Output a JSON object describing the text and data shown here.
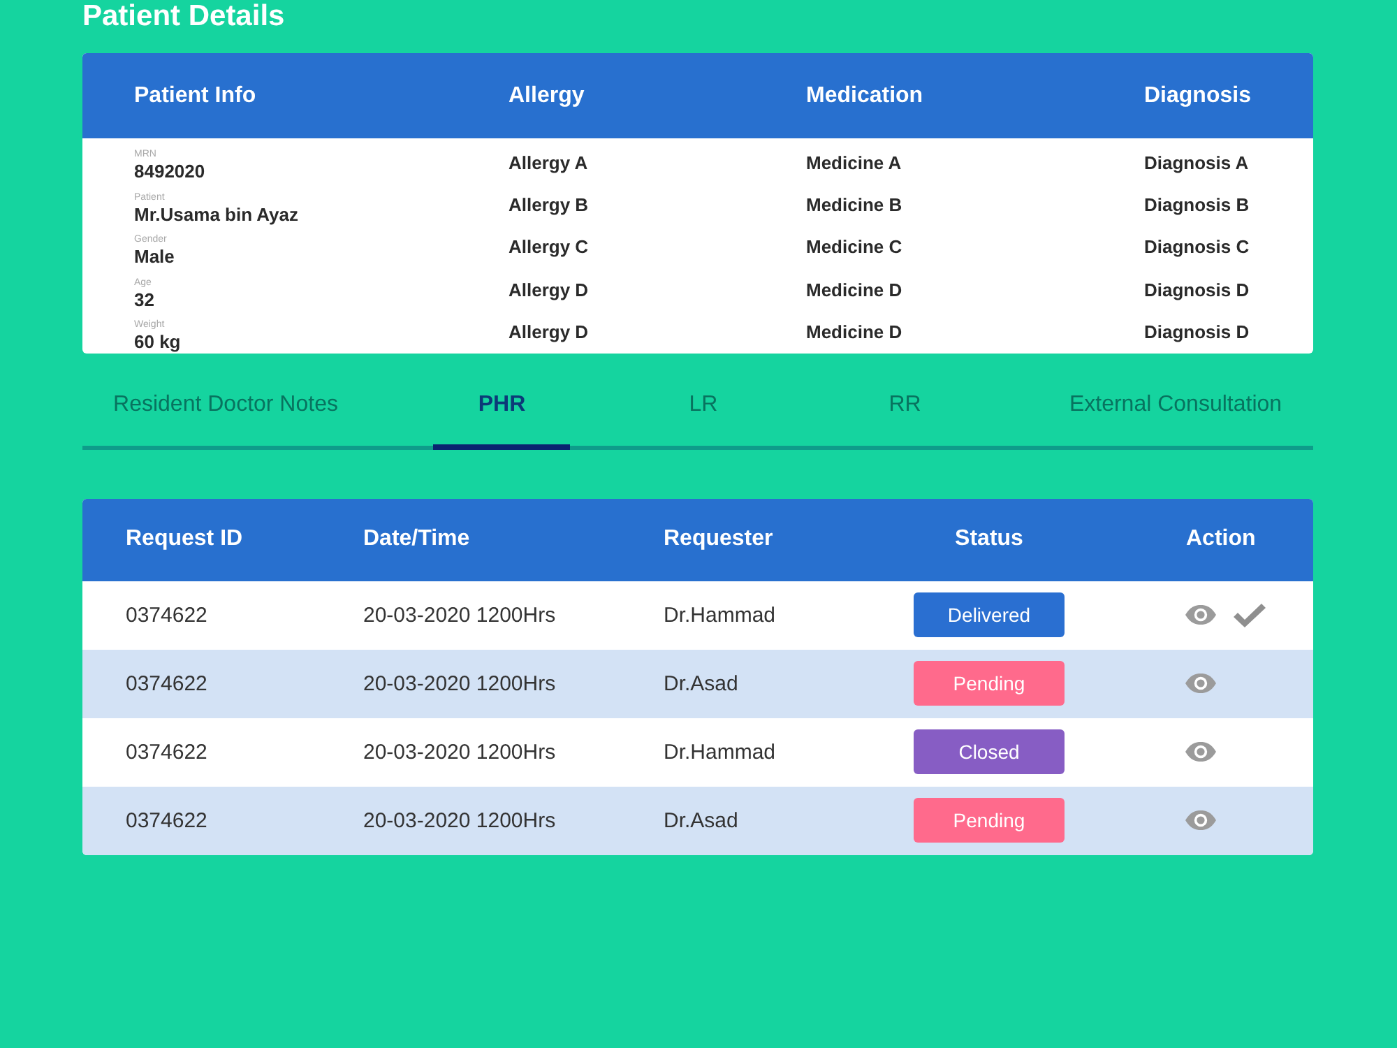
{
  "page": {
    "title": "Patient Details"
  },
  "patient_table": {
    "columns": [
      "Patient Info",
      "Allergy",
      "Medication",
      "Diagnosis"
    ],
    "rows": [
      {
        "info_label": "MRN",
        "info_value": "8492020",
        "allergy": "Allergy A",
        "medication": "Medicine A",
        "diagnosis": "Diagnosis A"
      },
      {
        "info_label": "Patient",
        "info_value": "Mr.Usama bin Ayaz",
        "allergy": "Allergy B",
        "medication": "Medicine B",
        "diagnosis": "Diagnosis B"
      },
      {
        "info_label": "Gender",
        "info_value": "Male",
        "allergy": "Allergy C",
        "medication": "Medicine C",
        "diagnosis": "Diagnosis C"
      },
      {
        "info_label": "Age",
        "info_value": "32",
        "allergy": "Allergy D",
        "medication": "Medicine D",
        "diagnosis": "Diagnosis D"
      },
      {
        "info_label": "Weight",
        "info_value": "60 kg",
        "allergy": "Allergy D",
        "medication": "Medicine D",
        "diagnosis": "Diagnosis D"
      }
    ]
  },
  "tabs": [
    {
      "label": "Resident Doctor Notes",
      "selected": false
    },
    {
      "label": "PHR",
      "selected": true
    },
    {
      "label": "LR",
      "selected": false
    },
    {
      "label": "RR",
      "selected": false
    },
    {
      "label": "External Consultation",
      "selected": false
    }
  ],
  "requests": {
    "columns": [
      "Request ID",
      "Date/Time",
      "Requester",
      "Status",
      "Action"
    ],
    "rows": [
      {
        "request_id": "0374622",
        "date_time": "20-03-2020 1200Hrs",
        "requester": "Dr.Hammad",
        "status": "Delivered",
        "color": "#2a6fd1",
        "actions": [
          {
            "kind": "view"
          },
          {
            "kind": "check"
          }
        ]
      },
      {
        "request_id": "0374622",
        "date_time": "20-03-2020 1200Hrs",
        "requester": "Dr.Asad",
        "status": "Pending",
        "color": "#ff6a8c",
        "actions": [
          {
            "kind": "view"
          }
        ]
      },
      {
        "request_id": "0374622",
        "date_time": "20-03-2020 1200Hrs",
        "requester": "Dr.Hammad",
        "status": "Closed",
        "color": "#875dc4",
        "actions": [
          {
            "kind": "view"
          }
        ]
      },
      {
        "request_id": "0374622",
        "date_time": "20-03-2020 1200Hrs",
        "requester": "Dr.Asad",
        "status": "Pending",
        "color": "#ff6a8c",
        "actions": [
          {
            "kind": "view"
          }
        ]
      }
    ]
  }
}
